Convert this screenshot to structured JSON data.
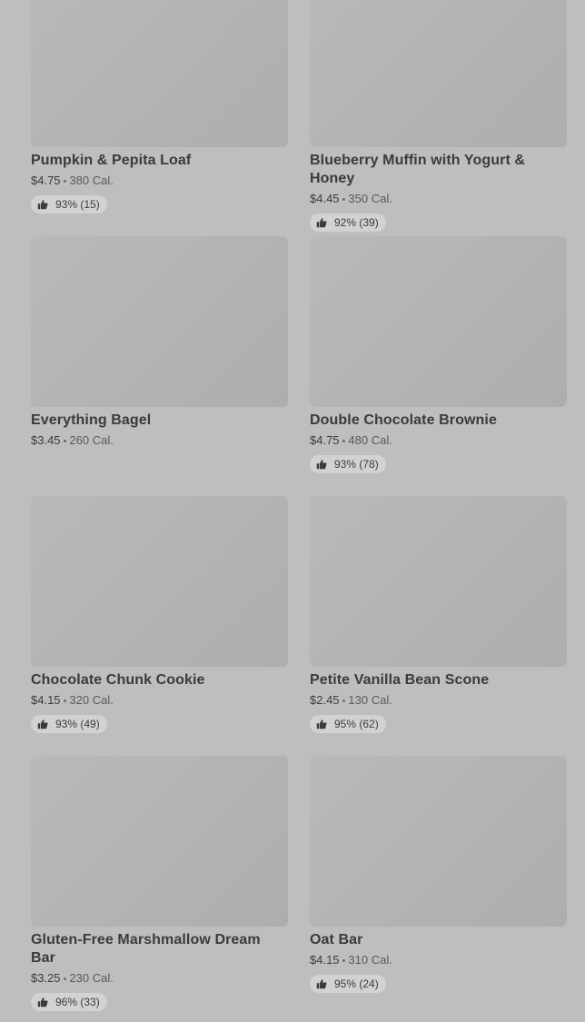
{
  "items": [
    {
      "name": "Pumpkin & Pepita Loaf",
      "price": "$4.75",
      "calories": "380 Cal.",
      "rating": "93% (15)"
    },
    {
      "name": "Blueberry Muffin with Yogurt & Honey",
      "price": "$4.45",
      "calories": "350 Cal.",
      "rating": "92% (39)"
    },
    {
      "name": "Everything Bagel",
      "price": "$3.45",
      "calories": "260 Cal.",
      "rating": null
    },
    {
      "name": "Double Chocolate Brownie",
      "price": "$4.75",
      "calories": "480 Cal.",
      "rating": "93% (78)"
    },
    {
      "name": "Chocolate Chunk Cookie",
      "price": "$4.15",
      "calories": "320 Cal.",
      "rating": "93% (49)"
    },
    {
      "name": "Petite Vanilla Bean Scone",
      "price": "$2.45",
      "calories": "130 Cal.",
      "rating": "95% (62)"
    },
    {
      "name": "Gluten-Free Marshmallow Dream Bar",
      "price": "$3.25",
      "calories": "230 Cal.",
      "rating": "96% (33)"
    },
    {
      "name": "Oat Bar",
      "price": "$4.15",
      "calories": "310 Cal.",
      "rating": "95% (24)"
    }
  ],
  "separator": "•",
  "rating_icon": "thumbs-up-icon"
}
